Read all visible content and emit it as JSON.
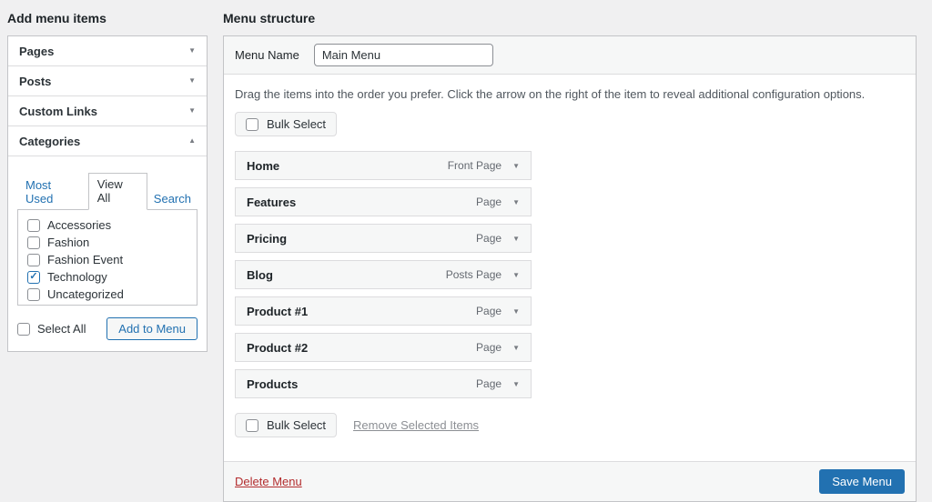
{
  "colors": {
    "accent": "#2271b1",
    "danger": "#b32d2e",
    "page_bg": "#f0f0f1",
    "row_bg": "#f6f7f7"
  },
  "icons": {
    "arrow_down": "▼",
    "arrow_up": "▲",
    "row_arrow": "▼",
    "checkmark": "✓"
  },
  "sidebar": {
    "title": "Add menu items",
    "collapsed_sections": [
      {
        "label": "Pages"
      },
      {
        "label": "Posts"
      },
      {
        "label": "Custom Links"
      }
    ],
    "categories": {
      "label": "Categories",
      "tabs": [
        {
          "label": "Most Used",
          "active": false
        },
        {
          "label": "View All",
          "active": true
        },
        {
          "label": "Search",
          "active": false
        }
      ],
      "items": [
        {
          "label": "Accessories",
          "checked": false
        },
        {
          "label": "Fashion",
          "checked": false
        },
        {
          "label": "Fashion Event",
          "checked": false
        },
        {
          "label": "Technology",
          "checked": true
        },
        {
          "label": "Uncategorized",
          "checked": false
        }
      ],
      "select_all_label": "Select All",
      "add_button_label": "Add to Menu"
    }
  },
  "menu": {
    "title": "Menu structure",
    "name_label": "Menu Name",
    "name_value": "Main Menu",
    "instructions": "Drag the items into the order you prefer. Click the arrow on the right of the item to reveal additional configuration options.",
    "bulk_select_label": "Bulk Select",
    "items": [
      {
        "label": "Home",
        "type": "Front Page"
      },
      {
        "label": "Features",
        "type": "Page"
      },
      {
        "label": "Pricing",
        "type": "Page"
      },
      {
        "label": "Blog",
        "type": "Posts Page"
      },
      {
        "label": "Product #1",
        "type": "Page"
      },
      {
        "label": "Product #2",
        "type": "Page"
      },
      {
        "label": "Products",
        "type": "Page"
      }
    ],
    "remove_selected_label": "Remove Selected Items",
    "footer": {
      "delete_label": "Delete Menu",
      "save_label": "Save Menu"
    }
  }
}
